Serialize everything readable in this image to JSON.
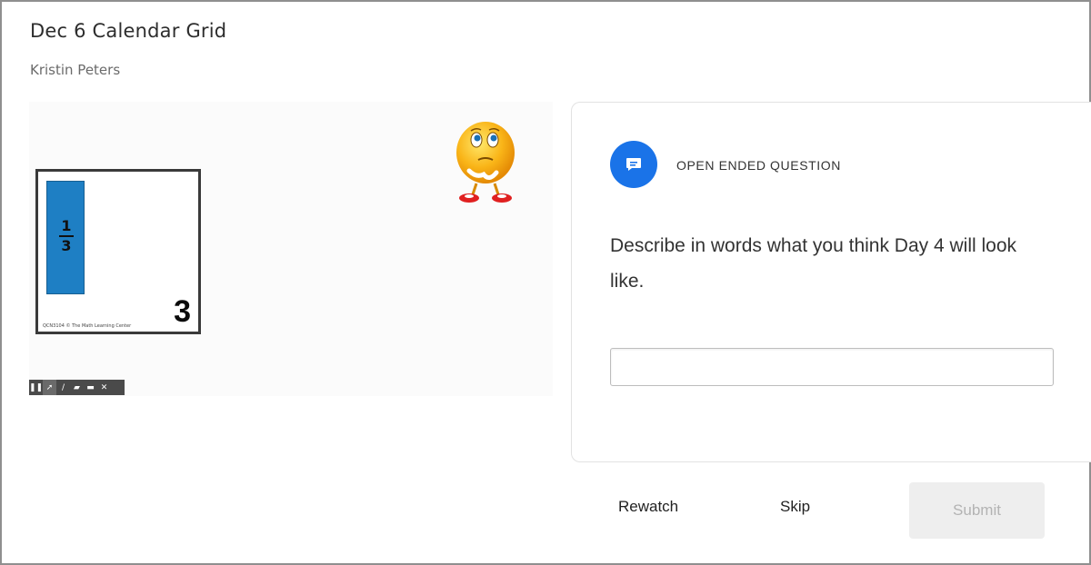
{
  "header": {
    "title": "Dec 6 Calendar Grid",
    "author": "Kristin Peters"
  },
  "video": {
    "card": {
      "fraction_numerator": "1",
      "fraction_denominator": "3",
      "day_number": "3",
      "credit": "QCN3104   © The Math Learning Center"
    },
    "controls": [
      {
        "icon": "pause-icon",
        "glyph": "❚❚"
      },
      {
        "icon": "pointer-icon",
        "glyph": "➚"
      },
      {
        "icon": "pen-icon",
        "glyph": "/"
      },
      {
        "icon": "highlighter-icon",
        "glyph": "▰"
      },
      {
        "icon": "eraser-icon",
        "glyph": "▬"
      },
      {
        "icon": "close-icon",
        "glyph": "✕"
      }
    ]
  },
  "question": {
    "type_label": "OPEN ENDED QUESTION",
    "text": "Describe in words what you think Day 4 will look like.",
    "answer_value": "",
    "icon": "chat-bubble-icon",
    "accent_color": "#1a73e8"
  },
  "actions": {
    "rewatch_label": "Rewatch",
    "skip_label": "Skip",
    "submit_label": "Submit"
  }
}
